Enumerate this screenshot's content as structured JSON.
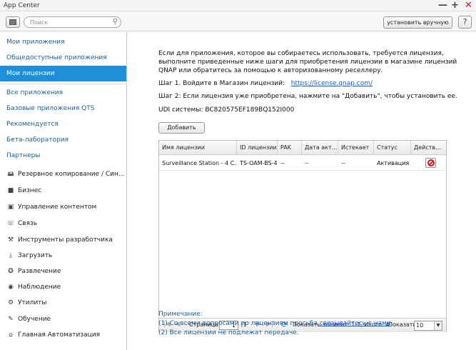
{
  "window": {
    "title": "App Center",
    "minimize": "—",
    "maximize": "+",
    "close": "✕"
  },
  "toolbar": {
    "search_placeholder": "Поиск",
    "search_icon": "⚲",
    "manual_install": "установить вручную",
    "help": "?"
  },
  "sidebar": {
    "primary": [
      "Мои приложения",
      "Общедоступные приложения",
      "Мои лицензии"
    ],
    "secondary": [
      "Все приложения",
      "Базовые приложения QTS",
      "Рекомендуется",
      "Бета-лаборатория",
      "Партнеры"
    ],
    "categories": [
      {
        "label": "Резервное копирование / Син...",
        "icon": "backup-icon",
        "glyph": "🖴"
      },
      {
        "label": "Бизнес",
        "icon": "briefcase-icon",
        "glyph": "■"
      },
      {
        "label": "Управление контентом",
        "icon": "cms-icon",
        "glyph": "▣"
      },
      {
        "label": "Связь",
        "icon": "communication-icon",
        "glyph": "☏"
      },
      {
        "label": "Инструменты разработчика",
        "icon": "wrench-icon",
        "glyph": "⚒"
      },
      {
        "label": "Загрузить",
        "icon": "download-icon",
        "glyph": "⤓"
      },
      {
        "label": "Развлечение",
        "icon": "entertainment-icon",
        "glyph": "✪"
      },
      {
        "label": "Наблюдение",
        "icon": "camera-icon",
        "glyph": "◉"
      },
      {
        "label": "Утилиты",
        "icon": "tools-icon",
        "glyph": "⚙"
      },
      {
        "label": "Обучение",
        "icon": "education-icon",
        "glyph": "✎"
      },
      {
        "label": "Главная Автоматизация",
        "icon": "home-icon",
        "glyph": "⌂"
      }
    ]
  },
  "main": {
    "intro": "Если для приложения, которое вы собираетесь использовать, требуется лицензия, выполните приведенные ниже шаги для приобретения лицензии в магазине лицензий QNAP или обратитесь за помощью к авторизованному реселлеру.",
    "step1_text": "Шаг 1. Войдите в Магазин лицензий:",
    "step1_link": "https://license.qnap.com/",
    "step2": "Шаг 2: Если лицензия уже приобретена, нажмите на \"Добавить\", чтобы установить ее.",
    "udi": "UDI системы: BC820575EF189BQ152I000",
    "add_button": "Добавить",
    "table": {
      "headers": [
        "Имя лицензии",
        "ID лицензии",
        "PAK",
        "Дата акт...",
        "Истекает",
        "Статус",
        "Действ..."
      ],
      "rows": [
        [
          "Surveillance Station - 4 C...",
          "TS-OAM-BS-4",
          "--",
          "--",
          "--",
          "Активация"
        ]
      ]
    },
    "pager": {
      "page_label": "Страница",
      "page_value": "1",
      "page_total": "/1",
      "summary": "Показать элемент: 1-1, Итого: 4",
      "show_label": "Показать",
      "page_size": "10"
    },
    "note_title": "Примечание:",
    "note1_prefix": "(1) Со всеми вопросами по лицензиям просьба ",
    "note1_link": "связывайтесь с нами",
    "note1_suffix": ".",
    "note2": "(2) Все лицензии не подлежат передаче."
  }
}
